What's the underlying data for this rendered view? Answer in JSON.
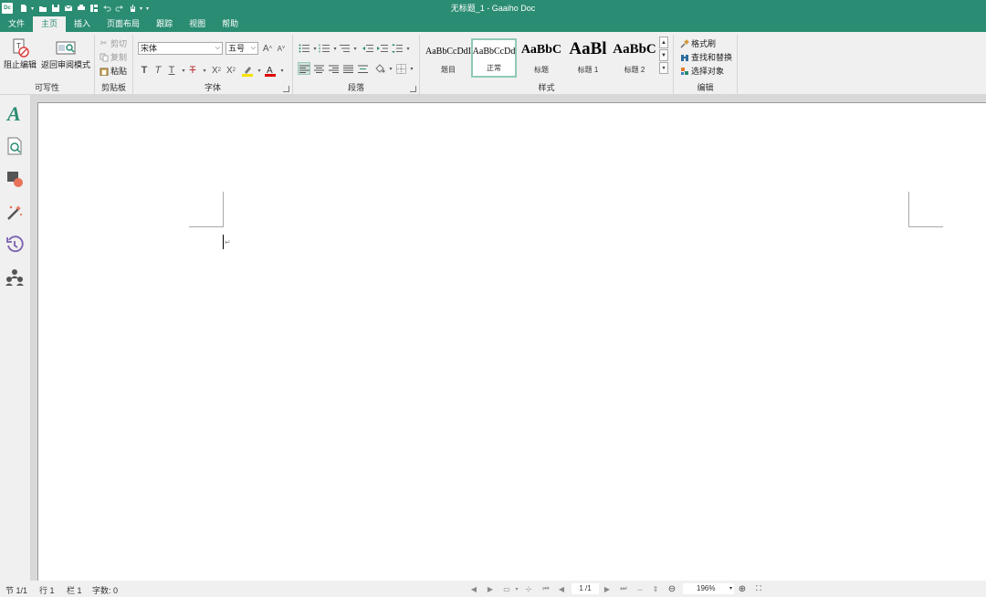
{
  "window": {
    "title": "无标题_1 - Gaaiho Doc",
    "logo_text": "Dc"
  },
  "menu": {
    "tabs": [
      "文件",
      "主页",
      "插入",
      "页面布局",
      "跟踪",
      "视图",
      "帮助"
    ],
    "active": "主页"
  },
  "ribbon": {
    "writability": {
      "label": "可写性",
      "block_edit": "阻止编辑",
      "return_review": "返回审阅模式"
    },
    "clipboard": {
      "label": "剪贴板",
      "cut": "剪切",
      "copy": "复制",
      "paste": "粘贴"
    },
    "font": {
      "label": "字体",
      "family": "宋体",
      "size": "五号"
    },
    "paragraph": {
      "label": "段落"
    },
    "styles": {
      "label": "样式",
      "items": [
        {
          "preview": "AaBbCcDdI",
          "name": "题目"
        },
        {
          "preview": "AaBbCcDd",
          "name": "正常"
        },
        {
          "preview": "AaBbC",
          "name": "标题"
        },
        {
          "preview": "AaBl",
          "name": "标题 1"
        },
        {
          "preview": "AaBbC",
          "name": "标题 2"
        }
      ]
    },
    "editing": {
      "label": "编辑",
      "format_painter": "格式刷",
      "find_replace": "查找和替换",
      "select_objects": "选择对象"
    }
  },
  "status": {
    "section": "节 1/1",
    "line": "行 1",
    "column": "栏 1",
    "word_count": "字数: 0",
    "page_current": "1",
    "page_total": "/1",
    "zoom": "196%"
  },
  "colors": {
    "accent": "#2a8c72",
    "highlight": "#f5e100",
    "font_color": "#e00000",
    "ribbon_bg": "#f0f0f0"
  }
}
